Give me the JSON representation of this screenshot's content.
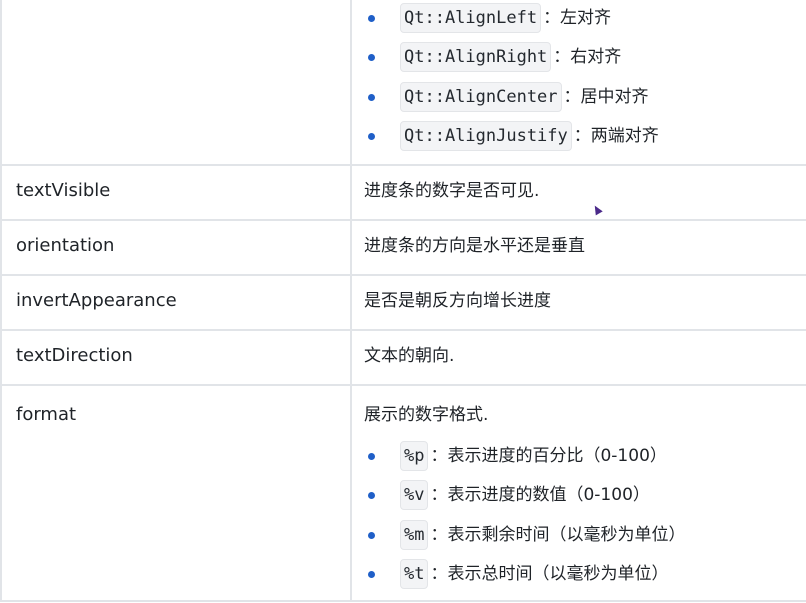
{
  "alignment_items": [
    {
      "code": "Qt::AlignLeft",
      "desc": "：左对齐"
    },
    {
      "code": "Qt::AlignRight",
      "desc": "：右对齐"
    },
    {
      "code": "Qt::AlignCenter",
      "desc": "：居中对齐"
    },
    {
      "code": "Qt::AlignJustify",
      "desc": "：两端对齐"
    }
  ],
  "rows": [
    {
      "name": "textVisible",
      "desc": "进度条的数字是否可见."
    },
    {
      "name": "orientation",
      "desc": "进度条的方向是水平还是垂直"
    },
    {
      "name": "invertAppearance",
      "desc": "是否是朝反方向增长进度"
    },
    {
      "name": "textDirection",
      "desc": "文本的朝向."
    }
  ],
  "format_row": {
    "name": "format",
    "intro": "展示的数字格式.",
    "items": [
      {
        "code": "%p",
        "desc": "：表示进度的百分比（0-100）"
      },
      {
        "code": "%v",
        "desc": "：表示进度的数值（0-100）"
      },
      {
        "code": "%m",
        "desc": "：表示剩余时间（以毫秒为单位）"
      },
      {
        "code": "%t",
        "desc": "：表示总时间（以毫秒为单位）"
      }
    ]
  },
  "colors": {
    "bullet": "#1f5fc8",
    "border": "#e1e4e8",
    "code_bg": "#f3f4f6"
  }
}
